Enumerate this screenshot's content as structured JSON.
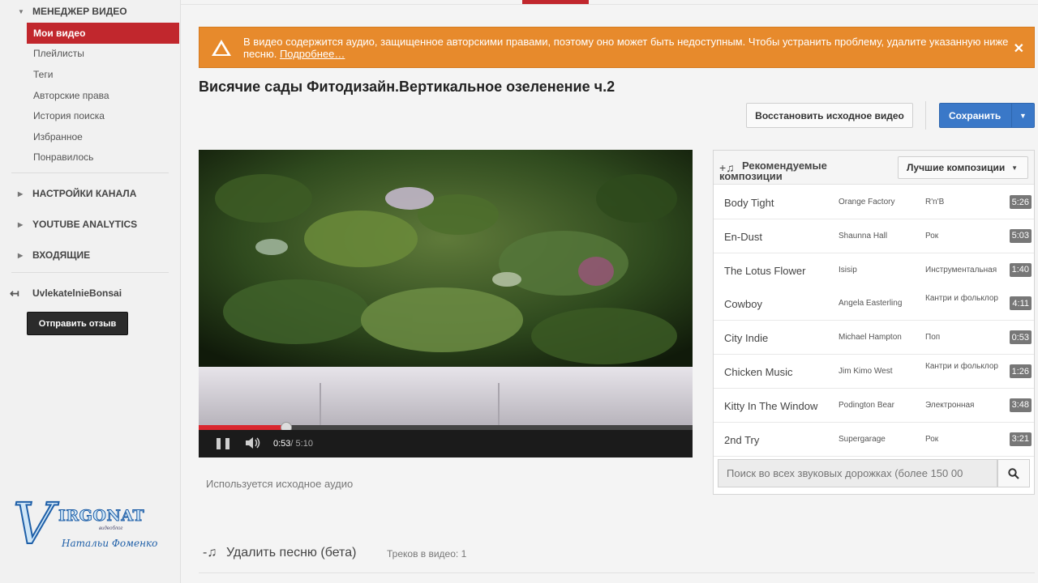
{
  "sidebar": {
    "section_video_manager": "МЕНЕДЖЕР ВИДЕО",
    "items": [
      {
        "label": "Мои видео"
      },
      {
        "label": "Плейлисты"
      },
      {
        "label": "Теги"
      },
      {
        "label": "Авторские права"
      },
      {
        "label": "История поиска"
      },
      {
        "label": "Избранное"
      },
      {
        "label": "Понравилось"
      }
    ],
    "section_channel_settings": "НАСТРОЙКИ КАНАЛА",
    "section_analytics": "YOUTUBE ANALYTICS",
    "section_inbox": "ВХОДЯЩИЕ",
    "channel_name": "UvlekatelnieBonsai",
    "feedback_label": "Отправить отзыв"
  },
  "logo": {
    "letter": "V",
    "brand": "IRGONAT",
    "sub1": "видеоблог",
    "sub2": "Натальи Фоменко"
  },
  "alert": {
    "message": "В видео содержится аудио, защищенное авторскими правами, поэтому оно может быть недоступным. Чтобы устранить проблему, удалите указанную ниже песню.",
    "more_link": "Подробнее…",
    "close": "✕",
    "color": "#e78a2c"
  },
  "page": {
    "title": "Висячие сады Фитодизайн.Вертикальное озеленение ч.2"
  },
  "actions": {
    "restore_label": "Восстановить исходное видео",
    "save_label": "Сохранить"
  },
  "player": {
    "current_time": "0:53",
    "duration": " / 5:10",
    "progress": 0.171
  },
  "audio_note": "Используется исходное аудио",
  "remove_song": {
    "title": "Удалить песню (бета)",
    "count": "Треков в видео: 1"
  },
  "tracks_panel": {
    "title": "Рекомендуемые композиции",
    "dropdown_value": "Лучшие композиции",
    "tracks": [
      {
        "name": "Body Tight",
        "artist": "Orange Factory",
        "genre": "R'n'B",
        "duration": "5:26"
      },
      {
        "name": "En-Dust",
        "artist": "Shaunna Hall",
        "genre": "Рок",
        "duration": "5:03"
      },
      {
        "name": "The Lotus Flower",
        "artist": "Isisip",
        "genre": "Инструментальная",
        "duration": "1:40"
      },
      {
        "name": "Cowboy",
        "artist": "Angela Easterling",
        "genre": "Кантри и фольклор",
        "duration": "4:11"
      },
      {
        "name": "City Indie",
        "artist": "Michael Hampton",
        "genre": "Поп",
        "duration": "0:53"
      },
      {
        "name": "Chicken Music",
        "artist": "Jim Kimo West",
        "genre": "Кантри и фольклор",
        "duration": "1:26"
      },
      {
        "name": "Kitty In The Window",
        "artist": "Podington Bear",
        "genre": "Электронная",
        "duration": "3:48"
      },
      {
        "name": "2nd Try",
        "artist": "Supergarage",
        "genre": "Рок",
        "duration": "3:21"
      }
    ],
    "search_placeholder": "Поиск во всех звуковых дорожках (более 150 00"
  },
  "colors": {
    "accent_red": "#c1272d",
    "save_blue": "#3a78c8",
    "alert_orange": "#e78a2c"
  },
  "icons": [
    "warning-icon",
    "close-icon",
    "triangle-right-icon",
    "back-arrow-icon",
    "music-note-icon",
    "pause-icon",
    "volume-icon",
    "search-icon",
    "chevron-down-icon"
  ]
}
